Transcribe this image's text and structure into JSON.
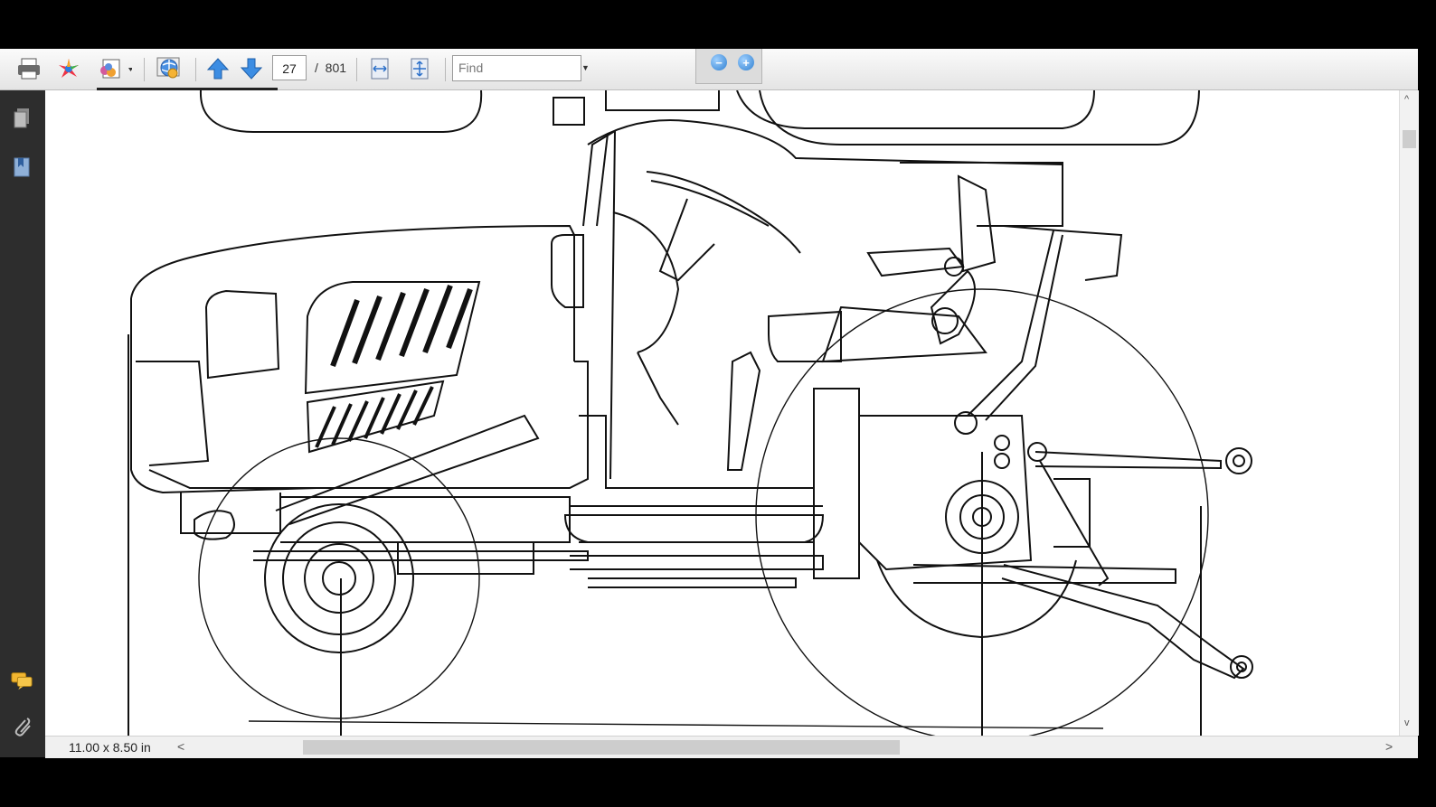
{
  "toolbar": {
    "page_current": "27",
    "page_separator": "/",
    "page_total": "801",
    "find_placeholder": "Find",
    "icons": {
      "print": "print-icon",
      "collab": "colorful-star-icon",
      "share": "share-icon",
      "globe": "web-globe-icon",
      "prev": "arrow-up-icon",
      "next": "arrow-down-icon",
      "fit_width": "fit-width-icon",
      "fit_page": "fit-page-icon",
      "zoom_out": "zoom-out-icon",
      "zoom_in": "zoom-in-icon"
    },
    "zoom_out_glyph": "−",
    "zoom_in_glyph": "+"
  },
  "left_nav": {
    "items": [
      "pages-icon",
      "bookmarks-icon",
      "comments-icon",
      "attachments-icon"
    ]
  },
  "document": {
    "content": "technical line drawing of compact tractor side view with rear three-point hitch"
  },
  "status": {
    "page_size": "11.00 x 8.50 in"
  },
  "scrollbar": {
    "left_arrow": "<",
    "right_arrow": ">",
    "up_arrow": "^",
    "down_arrow": "v"
  }
}
